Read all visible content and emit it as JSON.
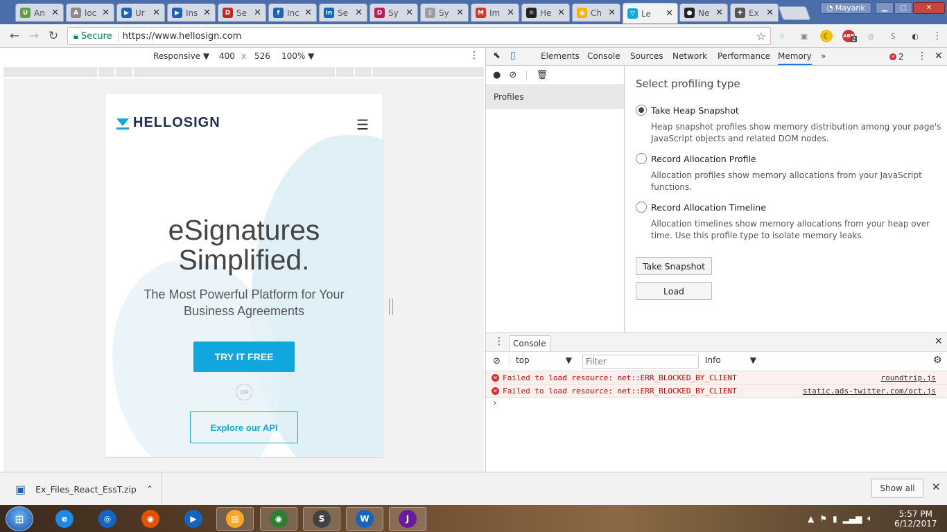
{
  "browser": {
    "tabs": [
      {
        "title": "An",
        "icon": "udemy-icon",
        "color": "#5aa23a",
        "glyph": "U"
      },
      {
        "title": "loc",
        "icon": "angular-icon",
        "color": "#8a8a8a",
        "glyph": "A"
      },
      {
        "title": "Ur",
        "icon": "video-icon",
        "color": "#1e63b5",
        "glyph": "▶"
      },
      {
        "title": "Ins",
        "icon": "video-icon",
        "color": "#1e63b5",
        "glyph": "▶"
      },
      {
        "title": "Se",
        "icon": "dash-icon",
        "color": "#c62828",
        "glyph": "D"
      },
      {
        "title": "Inc",
        "icon": "bulb-icon",
        "color": "#1e63b5",
        "glyph": "f"
      },
      {
        "title": "Se",
        "icon": "linkedin-icon",
        "color": "#0a66c2",
        "glyph": "in"
      },
      {
        "title": "Sy",
        "icon": "dp-icon",
        "color": "#c2185b",
        "glyph": "D"
      },
      {
        "title": "Sy",
        "icon": "document-icon",
        "color": "#9e9e9e",
        "glyph": "▯"
      },
      {
        "title": "Im",
        "icon": "gmail-icon",
        "color": "#d93025",
        "glyph": "M"
      },
      {
        "title": "He",
        "icon": "react-icon",
        "color": "#222222",
        "glyph": "⚛"
      },
      {
        "title": "Ch",
        "icon": "chrome-icon",
        "color": "#f4b400",
        "glyph": "◉"
      },
      {
        "title": "Le",
        "icon": "hellosign-icon",
        "color": "#12a6de",
        "glyph": "▽"
      },
      {
        "title": "Ne",
        "icon": "github-icon",
        "color": "#222222",
        "glyph": "●"
      },
      {
        "title": "Ex",
        "icon": "puzzle-icon",
        "color": "#555555",
        "glyph": "✚"
      }
    ],
    "active_tab_index": 12,
    "profile_name": "Mayank",
    "secure_label": "Secure",
    "url": "https://www.hellosign.com",
    "extension_badge": "2"
  },
  "device_toolbar": {
    "mode": "Responsive",
    "width": "400",
    "times": "x",
    "height": "526",
    "zoom": "100%"
  },
  "page": {
    "logo_text": "HELLOSIGN",
    "headline_line1": "eSignatures",
    "headline_line2": "Simplified.",
    "subheadline_line1": "The Most Powerful Platform for Your",
    "subheadline_line2": "Business Agreements",
    "try_button": "TRY IT FREE",
    "or_label": "OR",
    "api_button": "Explore our API"
  },
  "devtools": {
    "tabs": [
      "Elements",
      "Console",
      "Sources",
      "Network",
      "Performance",
      "Memory"
    ],
    "active_tab": "Memory",
    "more_tabs": "»",
    "error_count": "2",
    "profiles_label": "Profiles",
    "memory": {
      "title": "Select profiling type",
      "options": [
        {
          "label": "Take Heap Snapshot",
          "selected": true,
          "desc": "Heap snapshot profiles show memory distribution among your page's JavaScript objects and related DOM nodes."
        },
        {
          "label": "Record Allocation Profile",
          "selected": false,
          "desc": "Allocation profiles show memory allocations from your JavaScript functions."
        },
        {
          "label": "Record Allocation Timeline",
          "selected": false,
          "desc": "Allocation timelines show memory allocations from your heap over time. Use this profile type to isolate memory leaks."
        }
      ],
      "take_snapshot_button": "Take Snapshot",
      "load_button": "Load"
    },
    "console": {
      "tab_label": "Console",
      "context": "top",
      "filter_placeholder": "Filter",
      "level": "Info",
      "messages": [
        {
          "text": "Failed to load resource: net::ERR_BLOCKED_BY_CLIENT",
          "source": "roundtrip.js"
        },
        {
          "text": "Failed to load resource: net::ERR_BLOCKED_BY_CLIENT",
          "source": "static.ads-twitter.com/oct.js"
        }
      ],
      "prompt": "›"
    }
  },
  "download_bar": {
    "file_name": "Ex_Files_React_EssT.zip",
    "show_all": "Show all"
  },
  "taskbar": {
    "time": "5:57 PM",
    "date": "6/12/2017",
    "apps": [
      {
        "name": "ie-icon",
        "color": "#1e88e5",
        "glyph": "e"
      },
      {
        "name": "media-icon",
        "color": "#1565c0",
        "glyph": "◎"
      },
      {
        "name": "firefox-icon",
        "color": "#e65100",
        "glyph": "◉"
      },
      {
        "name": "player-icon",
        "color": "#1565c0",
        "glyph": "▶"
      },
      {
        "name": "explorer-icon",
        "color": "#f9a825",
        "glyph": "▤"
      },
      {
        "name": "chrome-icon",
        "color": "#2e7d32",
        "glyph": "◉"
      },
      {
        "name": "sublime-icon",
        "color": "#424242",
        "glyph": "S"
      },
      {
        "name": "word-icon",
        "color": "#1565c0",
        "glyph": "W"
      },
      {
        "name": "javaee-icon",
        "color": "#6a1b9a",
        "glyph": "J"
      }
    ]
  }
}
